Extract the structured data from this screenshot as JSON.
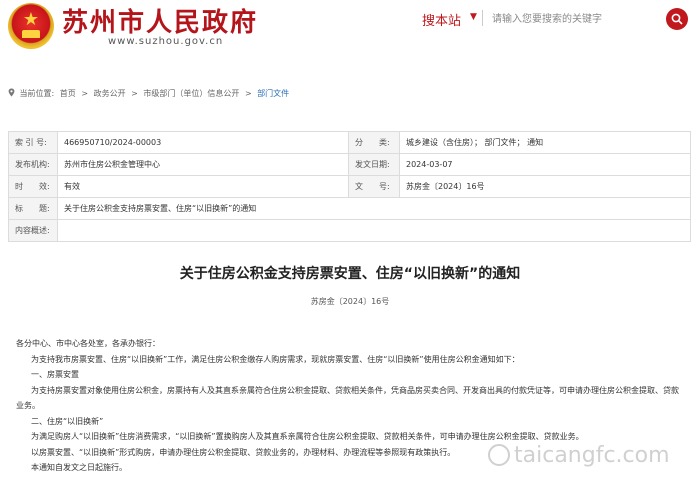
{
  "header": {
    "site_title": "苏州市人民政府",
    "site_url": "www.suzhou.gov.cn",
    "search_scope": "搜本站",
    "search_placeholder": "请输入您要搜索的关键字"
  },
  "breadcrumb": {
    "prefix": "当前位置:",
    "items": [
      "首页",
      ">",
      "政务公开",
      ">",
      "市级部门（单位）信息公开",
      ">",
      "部门文件"
    ]
  },
  "meta": {
    "rows": [
      {
        "label": "索 引 号:",
        "value": "466950710/2024-00003",
        "label2": "分　　类:",
        "value2": "城乡建设（含住房）；  部门文件；  通知"
      },
      {
        "label": "发布机构:",
        "value": "苏州市住房公积金管理中心",
        "label2": "发文日期:",
        "value2": "2024-03-07"
      },
      {
        "label": "时　　效:",
        "value": "有效",
        "label2": "文　　号:",
        "value2": "苏房金〔2024〕16号"
      }
    ],
    "title_label": "标　　题:",
    "title_value": "关于住房公积金支持房票安置、住房“以旧换新”的通知",
    "summary_label": "内容概述:",
    "summary_value": ""
  },
  "doc": {
    "title": "关于住房公积金支持房票安置、住房“以旧换新”的通知",
    "number": "苏房金〔2024〕16号",
    "paragraphs": [
      "各分中心、市中心各处室，各承办银行：",
      "为支持我市房票安置、住房“以旧换新”工作，满足住房公积金缴存人购房需求，现就房票安置、住房“以旧换新”使用住房公积金通知如下：",
      "一、房票安置",
      "为支持房票安置对象使用住房公积金，房票持有人及其直系亲属符合住房公积金提取、贷款相关条件，凭商品房买卖合同、开发商出具的付款凭证等，可申请办理住房公积金提取、贷款业务。",
      "二、住房“以旧换新”",
      "为满足购房人“以旧换新”住房消费需求，“以旧换新”置换购房人及其直系亲属符合住房公积金提取、贷款相关条件，可申请办理住房公积金提取、贷款业务。",
      "以房票安置、“以旧换新”形式购房，申请办理住房公积金提取、贷款业务的，办理材料、办理流程等参照现有政策执行。",
      "本通知自发文之日起施行。"
    ]
  },
  "watermark": "taicangfc.com",
  "colors": {
    "brand_red": "#b3151b",
    "link_blue": "#2a6fb8"
  }
}
